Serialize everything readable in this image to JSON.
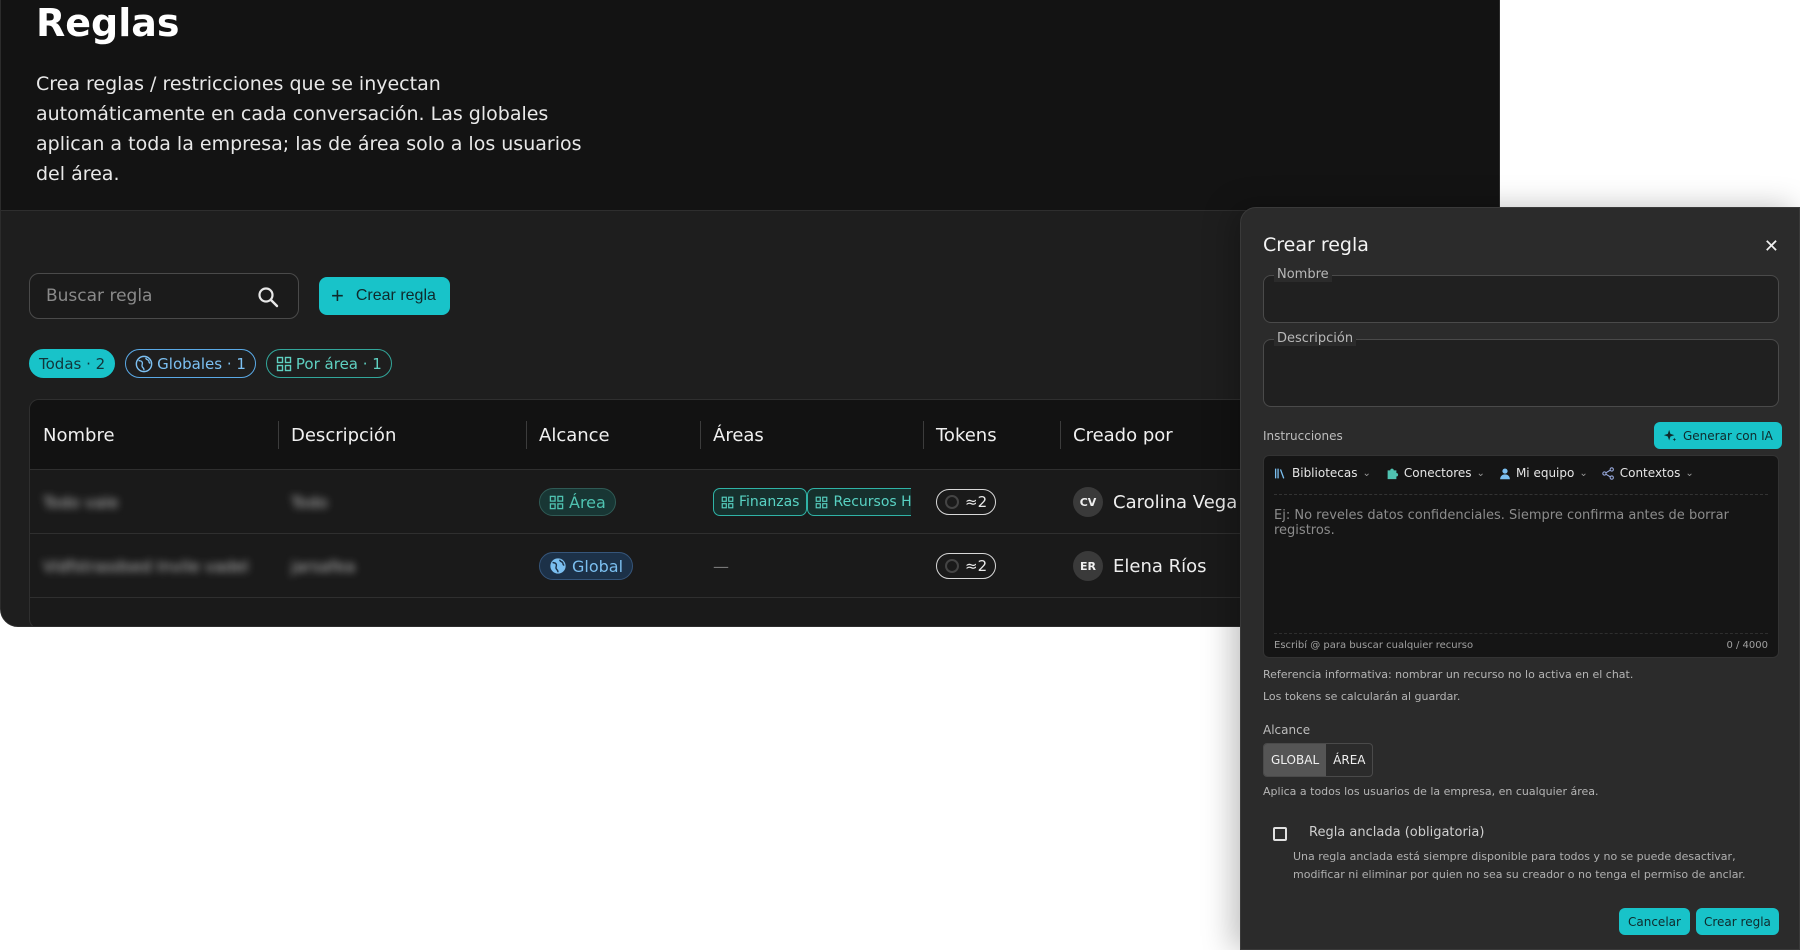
{
  "page": {
    "title": "Reglas",
    "description": "Crea reglas / restricciones que se inyectan automáticamente en cada conversación. Las globales aplican a toda la empresa; las de área solo a los usuarios del área."
  },
  "toolbar": {
    "search_placeholder": "Buscar regla",
    "create_label": "Crear regla"
  },
  "filters": [
    {
      "label": "Todas · 2",
      "icon": "none",
      "active": true
    },
    {
      "label": "Globales · 1",
      "icon": "globe-icon",
      "active": false
    },
    {
      "label": "Por área · 1",
      "icon": "grid-icon",
      "active": false
    }
  ],
  "table": {
    "columns": [
      "Nombre",
      "Descripción",
      "Alcance",
      "Áreas",
      "Tokens",
      "Creado por"
    ],
    "rows": [
      {
        "name": "Todo vale",
        "description": "Todo",
        "scope": "Área",
        "areas": [
          "Finanzas",
          "Recursos Hu"
        ],
        "tokens": "≈2",
        "creator_initials": "CV",
        "creator": "Carolina Vega"
      },
      {
        "name": "Vidfstrasdsed Invile vadel",
        "description": "jarsafea",
        "scope": "Global",
        "areas_empty": "—",
        "tokens": "≈2",
        "creator_initials": "ER",
        "creator": "Elena Ríos"
      }
    ]
  },
  "modal": {
    "title": "Crear regla",
    "name_label": "Nombre",
    "description_label": "Descripción",
    "instructions_label": "Instrucciones",
    "generate_label": "Generar con IA",
    "toolbar": [
      "Bibliotecas",
      "Conectores",
      "Mi equipo",
      "Contextos"
    ],
    "editor_placeholder": "Ej: No reveles datos confidenciales. Siempre confirma antes de borrar registros.",
    "editor_hint": "Escribí @ para buscar cualquier recurso",
    "editor_count": "0 / 4000",
    "note1": "Referencia informativa: nombrar un recurso no lo activa en el chat.",
    "note2": "Los tokens se calcularán al guardar.",
    "scope_label": "Alcance",
    "scope_options": [
      "GLOBAL",
      "ÁREA"
    ],
    "scope_selected": "GLOBAL",
    "scope_help": "Aplica a todos los usuarios de la empresa, en cualquier área.",
    "pinned_label": "Regla anclada (obligatoria)",
    "pinned_desc": "Una regla anclada está siempre disponible para todos y no se puede desactivar, modificar ni eliminar por quien no sea su creador o no tenga el permiso de anclar.",
    "cancel_label": "Cancelar",
    "submit_label": "Crear regla"
  },
  "colors": {
    "accent": "#18c3c9",
    "area": "#4fc3b1",
    "global": "#7bbff0"
  }
}
